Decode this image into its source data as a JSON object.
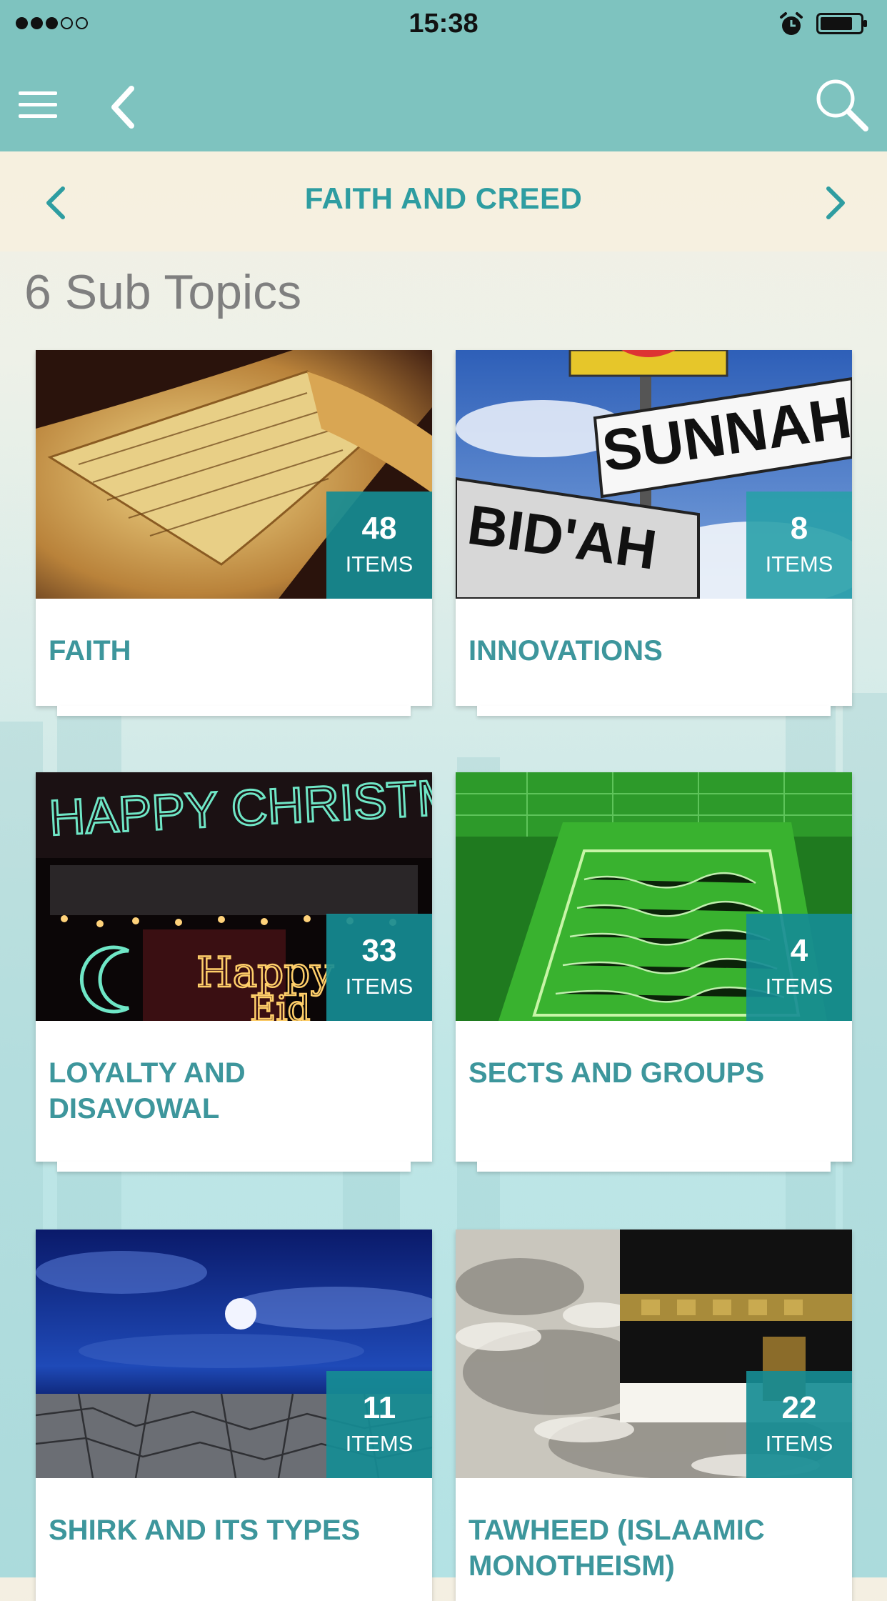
{
  "status_bar": {
    "time": "15:38",
    "signal_icon": "signal-dots-icon",
    "alarm_icon": "alarm-icon",
    "battery_icon": "battery-icon"
  },
  "app_bar": {
    "menu_icon": "hamburger-icon",
    "back_icon": "back-chevron-icon",
    "search_icon": "search-icon",
    "color": "#7ec3bf"
  },
  "topic": {
    "title": "FAITH AND CREED",
    "prev_icon": "chevron-left-icon",
    "next_icon": "chevron-right-icon",
    "accent": "#2e9da1"
  },
  "heading": "6 Sub Topics",
  "cards": [
    {
      "title": "FAITH",
      "count": "48",
      "count_label": "ITEMS",
      "image": "open quran book"
    },
    {
      "title": "INNOVATIONS",
      "count": "8",
      "count_label": "ITEMS",
      "image": "street signs"
    },
    {
      "title": "LOYALTY AND DISAVOWAL",
      "count": "33",
      "count_label": "ITEMS",
      "image": "neon greetings"
    },
    {
      "title": "SECTS AND GROUPS",
      "count": "4",
      "count_label": "ITEMS",
      "image": "green covered tomb"
    },
    {
      "title": "SHIRK AND ITS TYPES",
      "count": "11",
      "count_label": "ITEMS",
      "image": "moon over cracked earth"
    },
    {
      "title": "TAWHEED (ISLAAMIC MONOTHEISM)",
      "count": "22",
      "count_label": "ITEMS",
      "image": "kaaba pilgrims"
    }
  ],
  "card_images_text": {
    "sign_top": "SUNNAH",
    "sign_bottom": "BID'AH",
    "neon_top": "HAPPY CHRISTMAS",
    "neon_bottom_1": "Happy",
    "neon_bottom_2": "Eid"
  }
}
